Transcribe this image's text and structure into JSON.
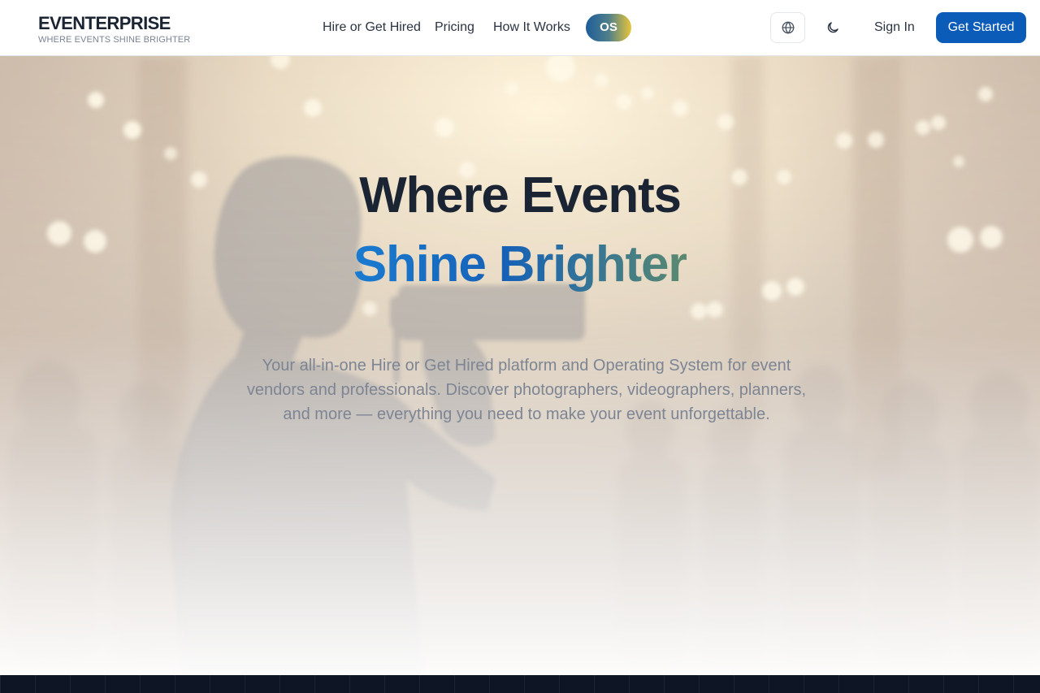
{
  "brand": {
    "name": "EVENTERPRISE",
    "tagline": "WHERE EVENTS SHINE BRIGHTER"
  },
  "nav": {
    "links": [
      "Hire or Get Hired",
      "Pricing",
      "How It Works"
    ],
    "os_badge": "OS",
    "language_icon": "globe-icon",
    "theme_icon": "moon-icon",
    "signin_label": "Sign In",
    "cta_label": "Get Started"
  },
  "hero": {
    "headline_line1": "Where Events",
    "headline_line2": "Shine Brighter",
    "description": "Your all-in-one Hire or Get Hired platform and Operating System for event vendors and professionals. Discover photographers, videographers, planners, and more — everything you need to make your event unforgettable.",
    "background_image": "videographer-filming-event-bokeh-lights"
  },
  "colors": {
    "primary": "#0b5bb8",
    "heading": "#1b2433",
    "gradient_start": "#1a7bd0",
    "gradient_end": "#5a8a6f",
    "os_badge_gold": "#e8c53a"
  }
}
